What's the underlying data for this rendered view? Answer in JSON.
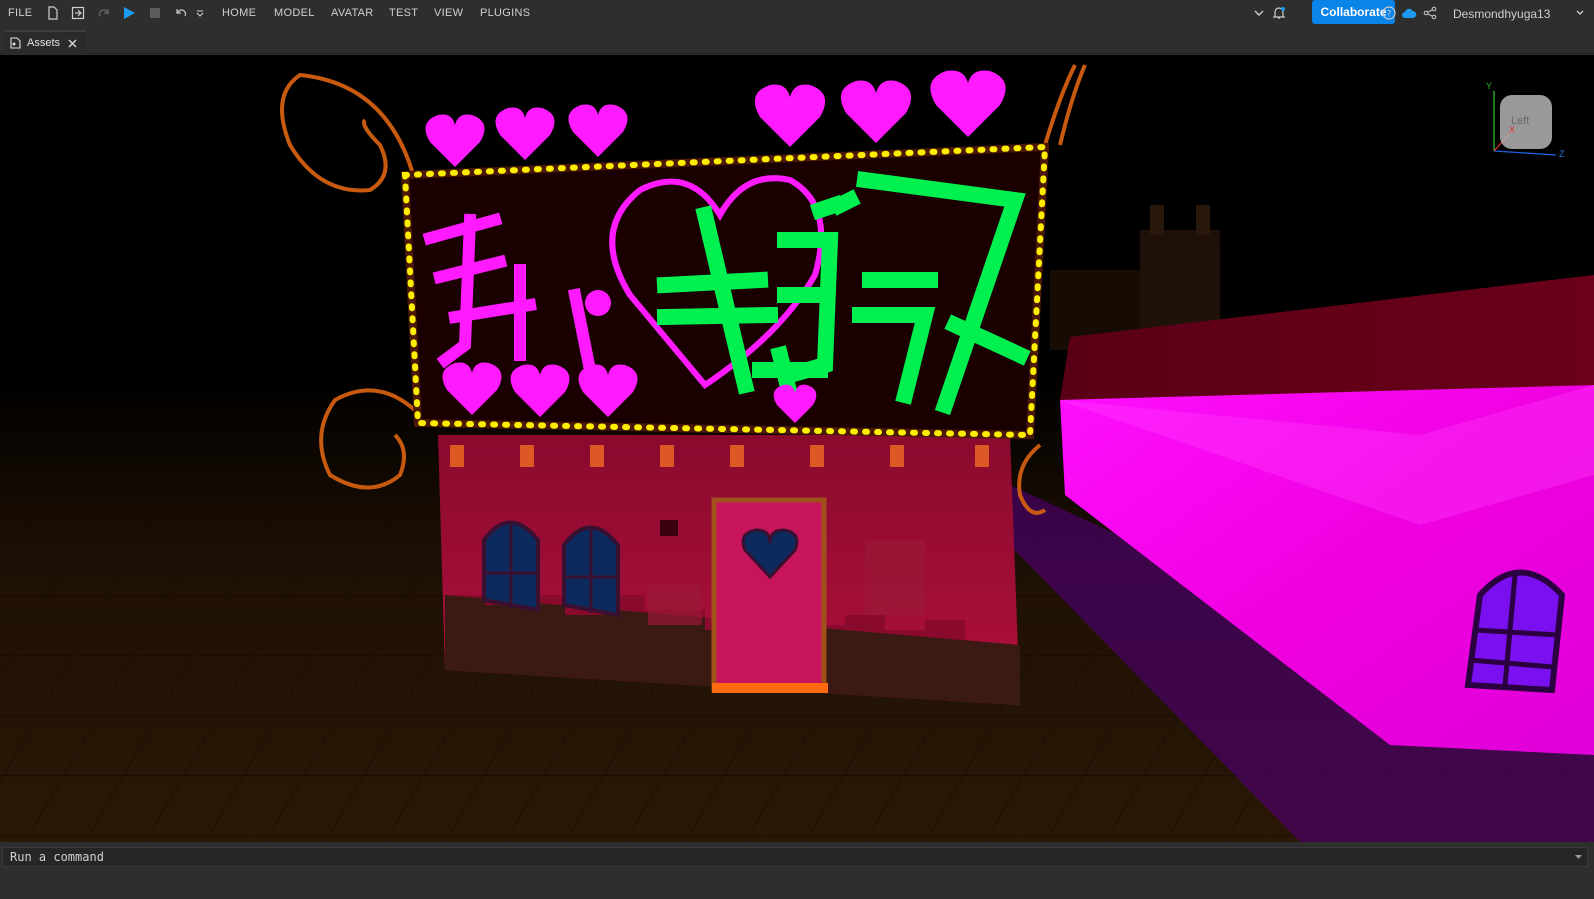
{
  "menu": {
    "file": "FILE",
    "tabs": [
      "HOME",
      "MODEL",
      "AVATAR",
      "TEST",
      "VIEW",
      "PLUGINS"
    ]
  },
  "toolbar_icons": [
    "new-file-icon",
    "publish-icon",
    "redo-icon",
    "play-icon",
    "stop-icon",
    "undo-icon",
    "dropdown-icon"
  ],
  "right": {
    "collaborate_label": "Collaborate",
    "username": "Desmondhyuga13"
  },
  "tab": {
    "label": "Assets"
  },
  "viewcube": {
    "face_label": "Left",
    "axis_y": "Y",
    "axis_z": "Z",
    "axis_x": "X"
  },
  "command": {
    "placeholder": "Run a command"
  },
  "colors": {
    "accent": "#0b84e8",
    "neon_pink": "#ff1aff",
    "neon_green": "#00f050",
    "bulb_yellow": "#ffee00"
  }
}
